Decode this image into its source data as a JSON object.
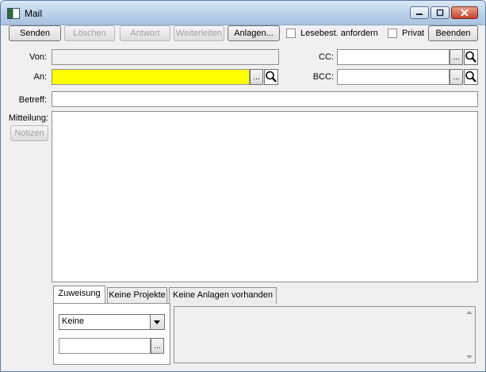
{
  "window": {
    "title": "Mail"
  },
  "toolbar": {
    "senden": "Senden",
    "loeschen": "Löschen",
    "antwort": "Antwort",
    "weiterleiten": "Weiterleiten",
    "anlagen": "Anlagen...",
    "lesebest_label": "Lesebest. anfordern",
    "privat_label": "Privat",
    "beenden": "Beenden"
  },
  "form": {
    "von_label": "Von:",
    "von_value": "",
    "an_label": "An:",
    "an_value": "",
    "cc_label": "CC:",
    "cc_value": "",
    "bcc_label": "BCC:",
    "bcc_value": "",
    "betreff_label": "Betreff:",
    "betreff_value": "",
    "mitteilung_label": "Mitteilung:",
    "notizen_button": "Notizen",
    "ellipsis": "..."
  },
  "tabs": [
    {
      "label": "Zuweisung",
      "active": true
    },
    {
      "label": "Keine Projekte",
      "active": false
    },
    {
      "label": "Keine Anlagen vorhanden",
      "active": false
    }
  ],
  "assignment": {
    "select_value": "Keine",
    "field_value": "",
    "ellipsis": "..."
  },
  "colors": {
    "highlight": "#ffff00",
    "titlebar": "#bdd2ea"
  }
}
